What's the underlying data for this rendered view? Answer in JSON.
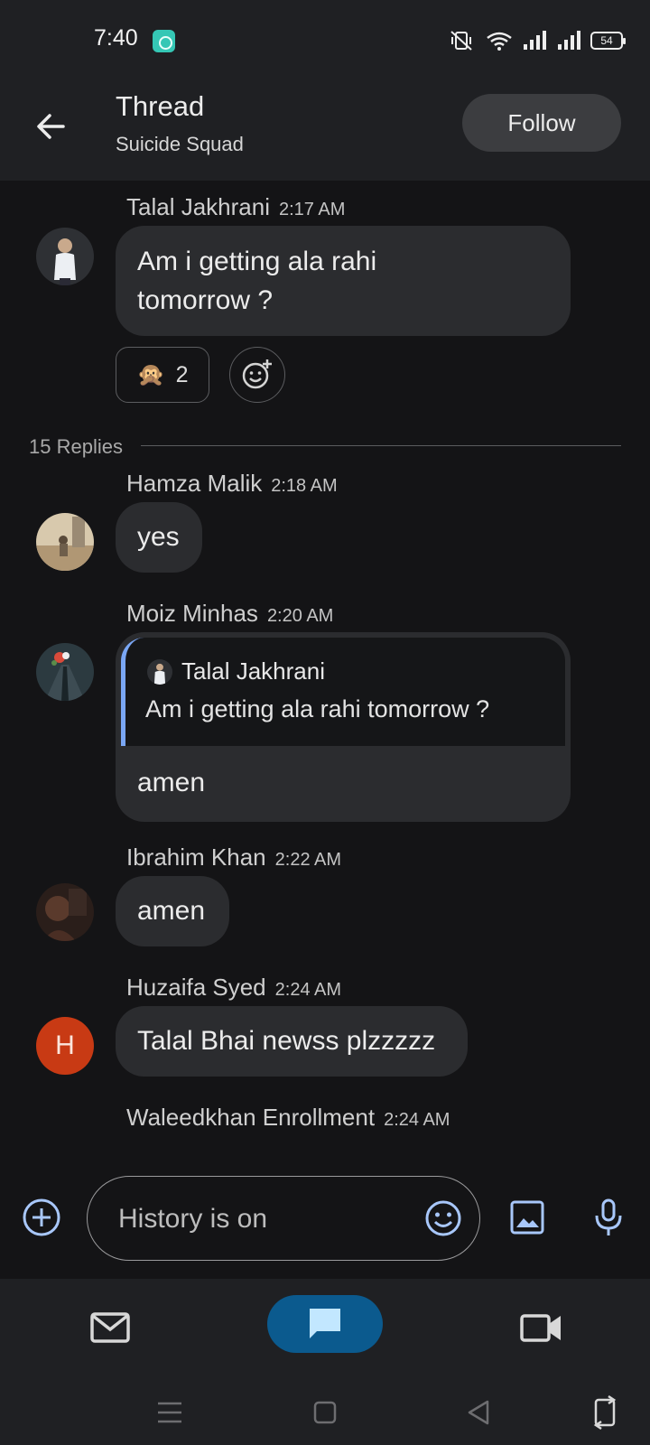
{
  "status_bar": {
    "time": "7:40",
    "battery": "54"
  },
  "header": {
    "title": "Thread",
    "subtitle": "Suicide Squad",
    "follow_label": "Follow"
  },
  "thread": {
    "root": {
      "sender": "Talal Jakhrani",
      "time": "2:17 AM",
      "text_line1": "Am i getting ala rahi",
      "text_line2": "tomorrow ?",
      "reaction": {
        "emoji": "🙊",
        "count": "2"
      }
    },
    "replies_label": "15 Replies",
    "replies": [
      {
        "sender": "Hamza Malik",
        "time": "2:18 AM",
        "text": "yes"
      },
      {
        "sender": "Moiz Minhas",
        "time": "2:20 AM",
        "quote": {
          "sender": "Talal Jakhrani",
          "text": "Am i getting ala rahi tomorrow ?"
        },
        "text": "amen"
      },
      {
        "sender": "Ibrahim Khan",
        "time": "2:22 AM",
        "text": "amen"
      },
      {
        "sender": "Huzaifa Syed",
        "time": "2:24 AM",
        "text": "Talal Bhai newss plzzzzz",
        "avatar_letter": "H"
      },
      {
        "sender": "Waleedkhan Enrollment",
        "time": "2:24 AM"
      }
    ]
  },
  "compose": {
    "placeholder": "History is on"
  },
  "colors": {
    "accent": "#7aa7f5",
    "nav_active": "#0b5a8e",
    "avatar_h": "#c83a14"
  }
}
